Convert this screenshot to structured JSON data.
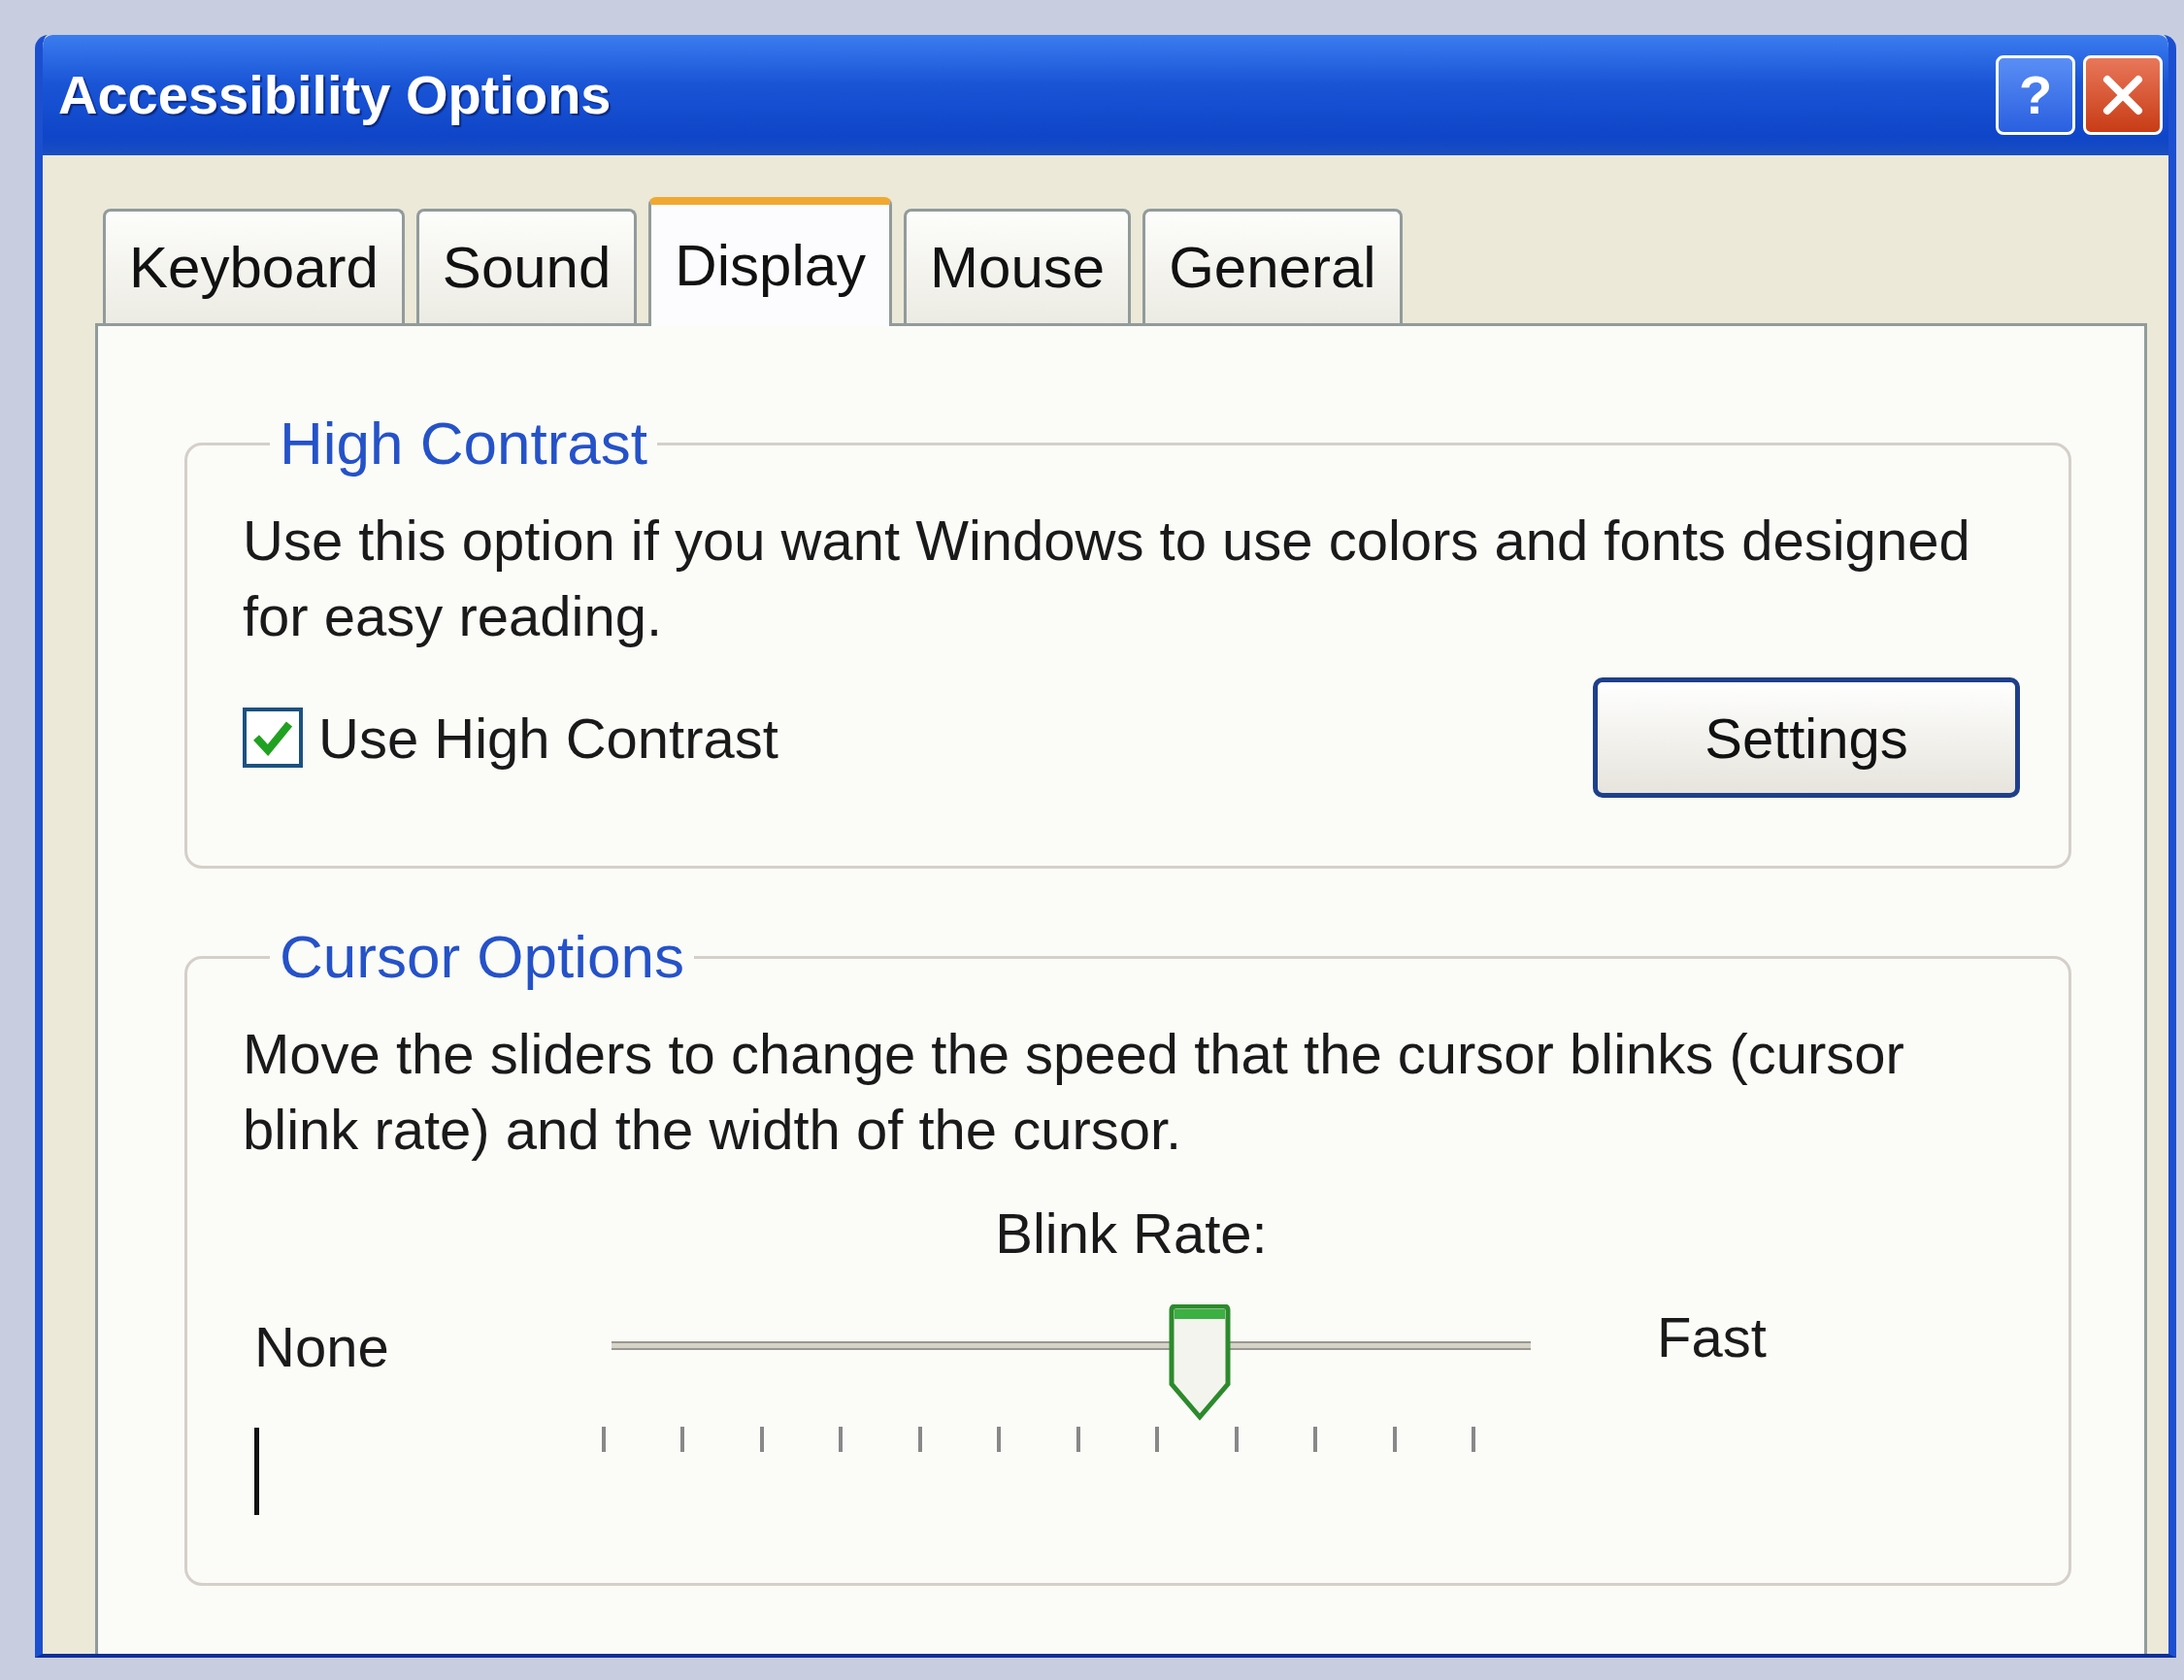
{
  "window": {
    "title": "Accessibility Options"
  },
  "title_buttons": [
    {
      "kind": "help",
      "label": "?"
    },
    {
      "kind": "close"
    }
  ],
  "tabs": [
    {
      "label": "Keyboard",
      "selected": false
    },
    {
      "label": "Sound",
      "selected": false
    },
    {
      "label": "Display",
      "selected": true
    },
    {
      "label": "Mouse",
      "selected": false
    },
    {
      "label": "General",
      "selected": false
    }
  ],
  "high_contrast": {
    "legend": "High Contrast",
    "description": "Use this option if you want Windows to use colors and fonts designed for easy reading.",
    "checkbox": {
      "label": "Use High Contrast",
      "checked": true
    },
    "settings_button": "Settings"
  },
  "cursor_options": {
    "legend": "Cursor Options",
    "description": "Move the sliders to change the speed that the cursor blinks (cursor blink rate) and the width of the cursor.",
    "blink_rate": {
      "label": "Blink Rate:",
      "min_label": "None",
      "max_label": "Fast",
      "level": 0.64
    }
  }
}
